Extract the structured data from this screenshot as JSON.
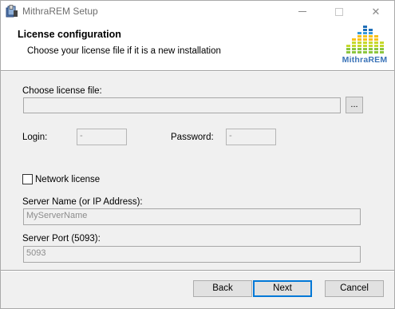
{
  "window": {
    "title": "MithraREM Setup",
    "icons": {
      "app": "installer-icon",
      "minimize": "minimize-icon",
      "maximize": "maximize-icon",
      "close": "close-icon"
    },
    "close_glyph": "✕"
  },
  "banner": {
    "title": "License configuration",
    "subtitle": "Choose your license file if it is a new installation",
    "logo_text": "MithraREM",
    "logo_colors": [
      "#8cc63f",
      "#c6d92d",
      "#f7c21b",
      "#3a9ad9",
      "#1f6fb8"
    ]
  },
  "form": {
    "license_file": {
      "label": "Choose license file:",
      "value": "",
      "browse_label": "..."
    },
    "login": {
      "label": "Login:",
      "value": "-"
    },
    "password": {
      "label": "Password:",
      "value": "-"
    },
    "network_license": {
      "label": "Network license",
      "checked": false
    },
    "server_name": {
      "label": "Server Name (or IP Address):",
      "value": "MyServerName"
    },
    "server_port": {
      "label": "Server Port (5093):",
      "value": "5093"
    }
  },
  "buttons": {
    "back": "Back",
    "next": "Next",
    "cancel": "Cancel"
  }
}
